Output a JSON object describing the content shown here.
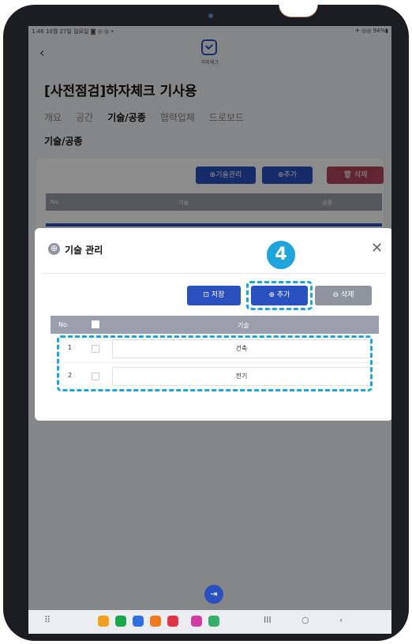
{
  "status_bar": {
    "left": "1:46  10월 27일 일요일  ◙ ◎ ◎ •",
    "right": "✈ ◎◎ 94%▮"
  },
  "header": {
    "back_icon": "‹",
    "logo_label": "하자체크"
  },
  "page": {
    "title": "[사전점검]하자체크 기사용",
    "tabs": [
      "개요",
      "공간",
      "기술/공종",
      "협력업체",
      "드로보드"
    ],
    "active_tab": "기술/공종",
    "section_heading": "기술/공종"
  },
  "background_panel": {
    "buttons": {
      "tech_manage": "⊕기술관리",
      "add": "⊕추가",
      "delete": "🗑 삭제"
    },
    "columns": [
      "No.",
      "기술",
      "공종"
    ]
  },
  "modal": {
    "icon": "⊕",
    "title": "기술 관리",
    "close_icon": "✕",
    "step_marker": "4",
    "buttons": {
      "save": "⊡ 저장",
      "add": "⊕ 추가",
      "delete": "⊖ 삭제"
    },
    "table": {
      "columns": [
        "No.",
        "기술"
      ],
      "rows": [
        {
          "no": "1",
          "value": "건축"
        },
        {
          "no": "2",
          "value": "전기"
        }
      ]
    }
  },
  "fab_icon": "⇥",
  "nav": {
    "apps_icon": "⠿",
    "recent": "III",
    "home": "○",
    "back": "‹"
  },
  "colors": {
    "primary": "#2a4fbf",
    "highlight": "#1da5dc",
    "gray_button": "#8f949e"
  }
}
